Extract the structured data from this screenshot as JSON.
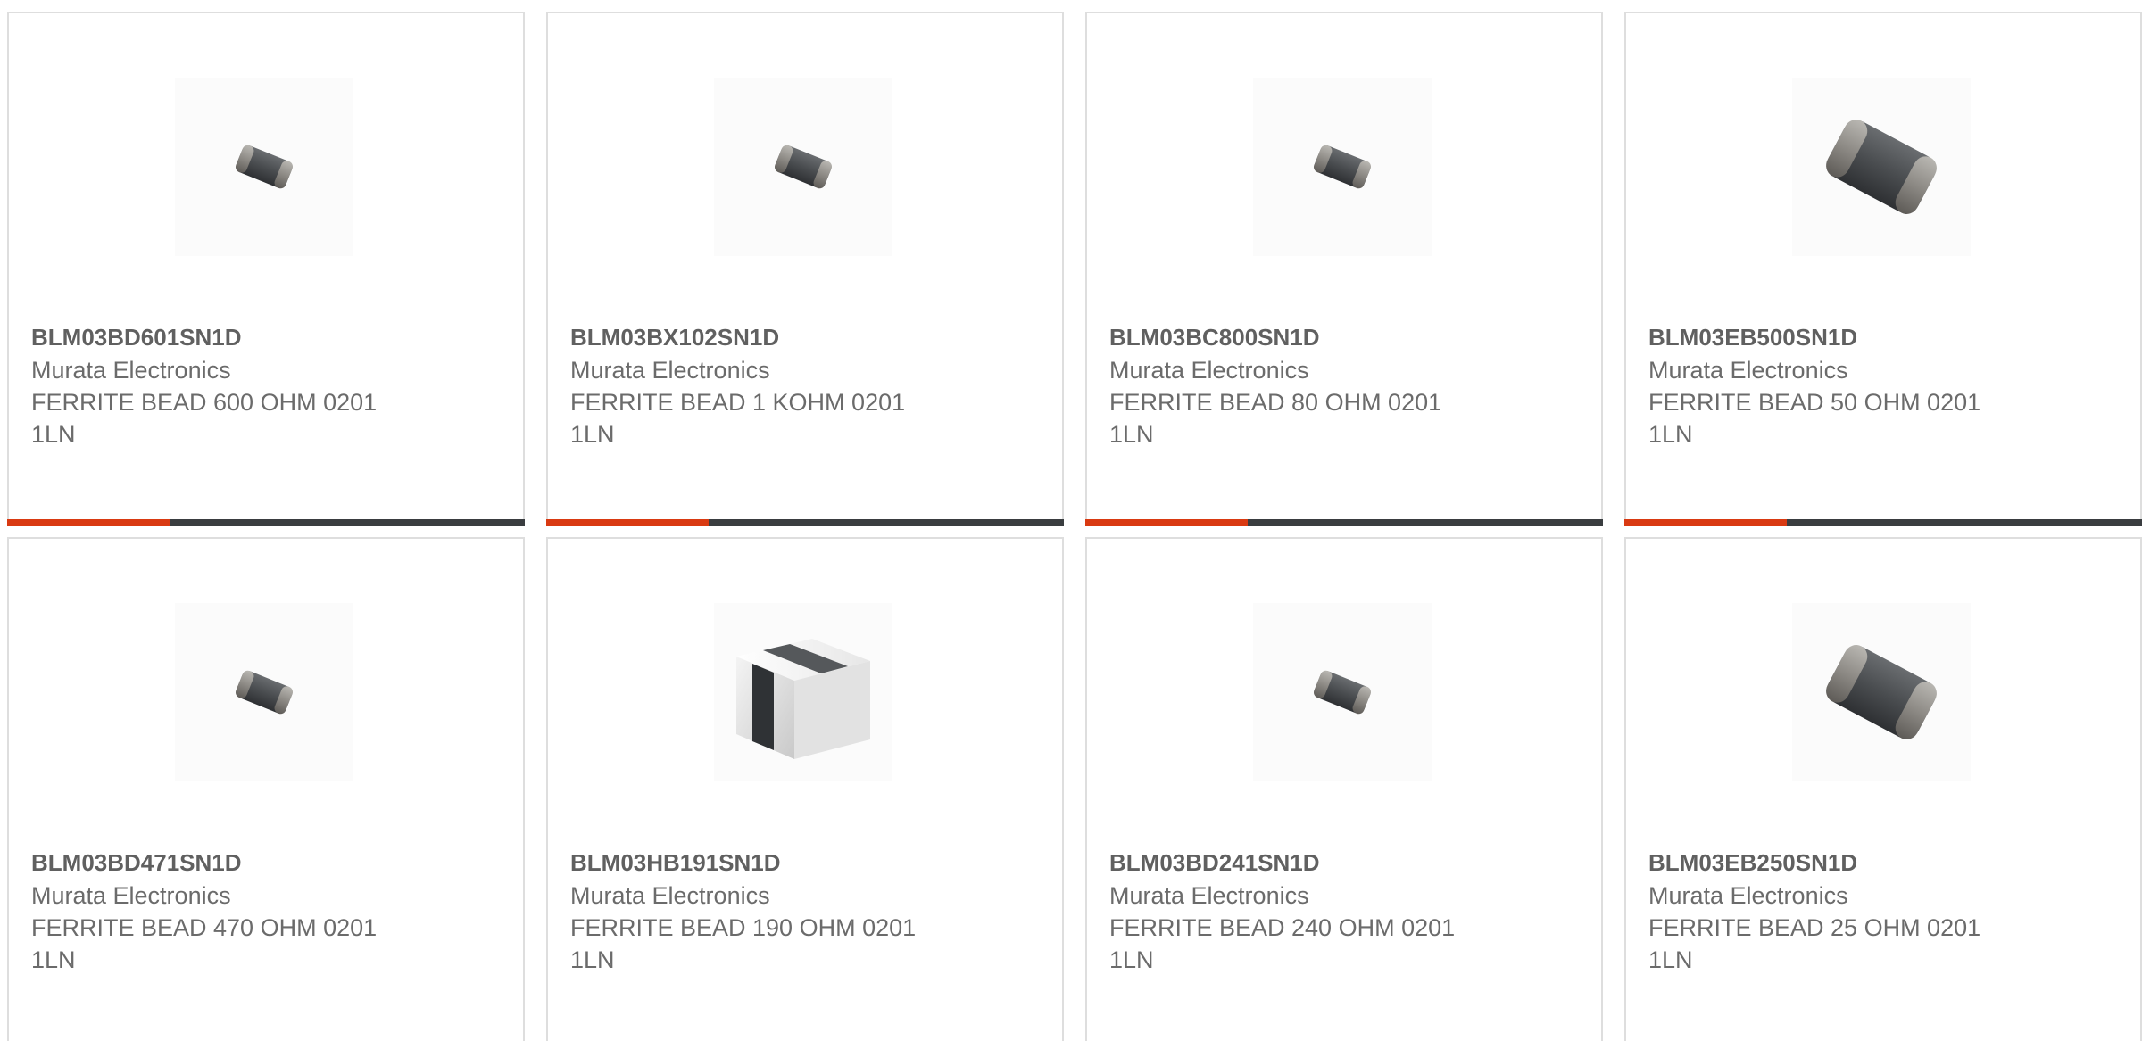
{
  "products": [
    {
      "part_number": "BLM03BD601SN1D",
      "manufacturer": "Murata Electronics",
      "description_line1": "FERRITE BEAD 600 OHM 0201",
      "description_line2": "1LN",
      "image_icon": "ferrite-bead-small-icon"
    },
    {
      "part_number": "BLM03BX102SN1D",
      "manufacturer": "Murata Electronics",
      "description_line1": "FERRITE BEAD 1 KOHM 0201",
      "description_line2": "1LN",
      "image_icon": "ferrite-bead-small-icon"
    },
    {
      "part_number": "BLM03BC800SN1D",
      "manufacturer": "Murata Electronics",
      "description_line1": "FERRITE BEAD 80 OHM 0201",
      "description_line2": "1LN",
      "image_icon": "ferrite-bead-small-icon"
    },
    {
      "part_number": "BLM03EB500SN1D",
      "manufacturer": "Murata Electronics",
      "description_line1": "FERRITE BEAD 50 OHM 0201",
      "description_line2": "1LN",
      "image_icon": "ferrite-bead-large-icon"
    },
    {
      "part_number": "BLM03BD471SN1D",
      "manufacturer": "Murata Electronics",
      "description_line1": "FERRITE BEAD 470 OHM 0201",
      "description_line2": "1LN",
      "image_icon": "ferrite-bead-small-icon"
    },
    {
      "part_number": "BLM03HB191SN1D",
      "manufacturer": "Murata Electronics",
      "description_line1": "FERRITE BEAD 190 OHM 0201",
      "description_line2": "1LN",
      "image_icon": "chip-block-icon"
    },
    {
      "part_number": "BLM03BD241SN1D",
      "manufacturer": "Murata Electronics",
      "description_line1": "FERRITE BEAD 240 OHM 0201",
      "description_line2": "1LN",
      "image_icon": "ferrite-bead-small-icon"
    },
    {
      "part_number": "BLM03EB250SN1D",
      "manufacturer": "Murata Electronics",
      "description_line1": "FERRITE BEAD 25 OHM 0201",
      "description_line2": "1LN",
      "image_icon": "ferrite-bead-large-icon"
    }
  ],
  "colors": {
    "accent": "#d93a12",
    "bar": "#3a3d40",
    "text": "#6b6b6b",
    "border": "#dedede"
  }
}
